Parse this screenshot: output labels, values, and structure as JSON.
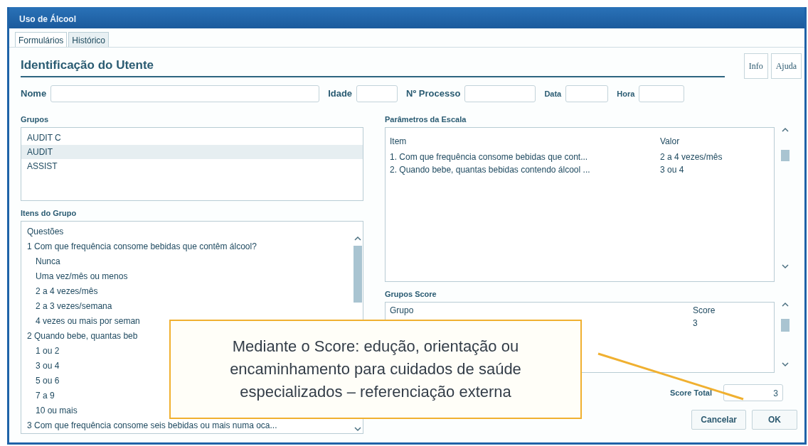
{
  "window": {
    "title": "Uso de Álcool"
  },
  "tabs": [
    {
      "label": "Formulários",
      "selected": true
    },
    {
      "label": "Histórico",
      "selected": false
    }
  ],
  "section_title": "Identificação do Utente",
  "header_buttons": [
    "Info",
    "Ajuda"
  ],
  "fields": [
    {
      "label": "Nome"
    },
    {
      "label": "Idade"
    },
    {
      "label": "Nº Processo"
    },
    {
      "label": "Data"
    },
    {
      "label": "Hora"
    }
  ],
  "groups": {
    "label": "Grupos",
    "items": [
      {
        "label": "AUDIT C",
        "selected": false
      },
      {
        "label": "AUDIT",
        "selected": true
      },
      {
        "label": "ASSIST",
        "selected": false
      }
    ]
  },
  "group_items": {
    "label": "Itens do Grupo",
    "header": "Questões",
    "questions": [
      {
        "label": "1 Com que frequência consome bebidas que contêm álcool?",
        "children": [
          {
            "label": "Nunca"
          },
          {
            "label": "Uma vez/mês ou menos"
          },
          {
            "label": "2 a 4 vezes/mês"
          },
          {
            "label": "2 a 3 vezes/semana"
          },
          {
            "label": "4 vezes ou mais por seman"
          }
        ]
      },
      {
        "label": "2 Quando bebe, quantas beb",
        "children": [
          {
            "label": "1 ou 2"
          },
          {
            "label": "3 ou 4"
          },
          {
            "label": "5 ou 6"
          },
          {
            "label": "7 a 9"
          },
          {
            "label": "10 ou mais"
          }
        ]
      },
      {
        "label": "3 Com que frequência consome seis bebidas ou mais numa oca..."
      }
    ]
  },
  "scale_parameters": {
    "label": "Parâmetros da Escala",
    "columns": [
      "Item",
      "Valor"
    ],
    "rows": [
      [
        "1. Com que frequência consome bebidas que cont...",
        "2 a 4 vezes/mês"
      ],
      [
        "2. Quando bebe, quantas bebidas contendo álcool ...",
        "3 ou 4"
      ]
    ]
  },
  "group_scores": {
    "label": "Grupos Score",
    "columns": [
      "Grupo",
      "Score"
    ],
    "rows": [
      {
        "score": "3"
      }
    ]
  },
  "score_total": {
    "label": "Score Total",
    "value": "3"
  },
  "buttons": [
    "Cancelar",
    "OK"
  ],
  "callout": {
    "text": "Mediante o Score: edução, orientação ou encaminhamento para cuidados de saúde especializados – referenciação externa"
  }
}
